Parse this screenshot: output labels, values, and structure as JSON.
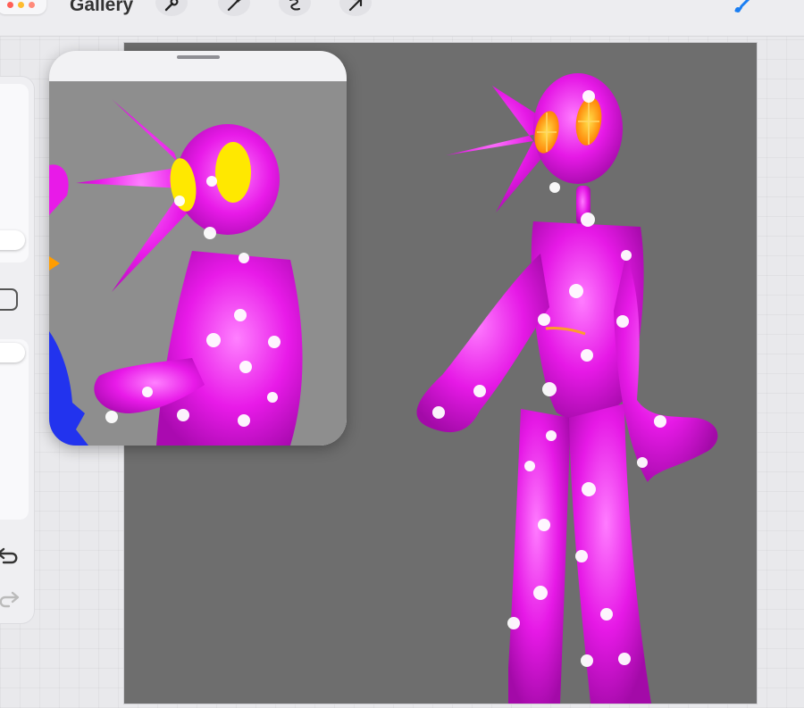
{
  "toolbar": {
    "gallery_label": "Gallery",
    "tools": [
      "wrench-icon",
      "magic-wand-icon",
      "selection-icon",
      "transform-icon"
    ],
    "brush_icon": "paintbrush-icon"
  },
  "colors": {
    "accent": "#1a7ef2",
    "canvas_bg": "#6e6e6e",
    "reference_bg": "#8e8e8e",
    "figure_pink": "#e816e8",
    "eye_yellow": "#f5c520",
    "eye_orange": "#ff7a00",
    "blue": "#2233ee"
  },
  "sidebar": {
    "buttons": [
      "brush-size-slider",
      "modify-button",
      "opacity-slider",
      "undo-icon",
      "redo-icon"
    ]
  }
}
